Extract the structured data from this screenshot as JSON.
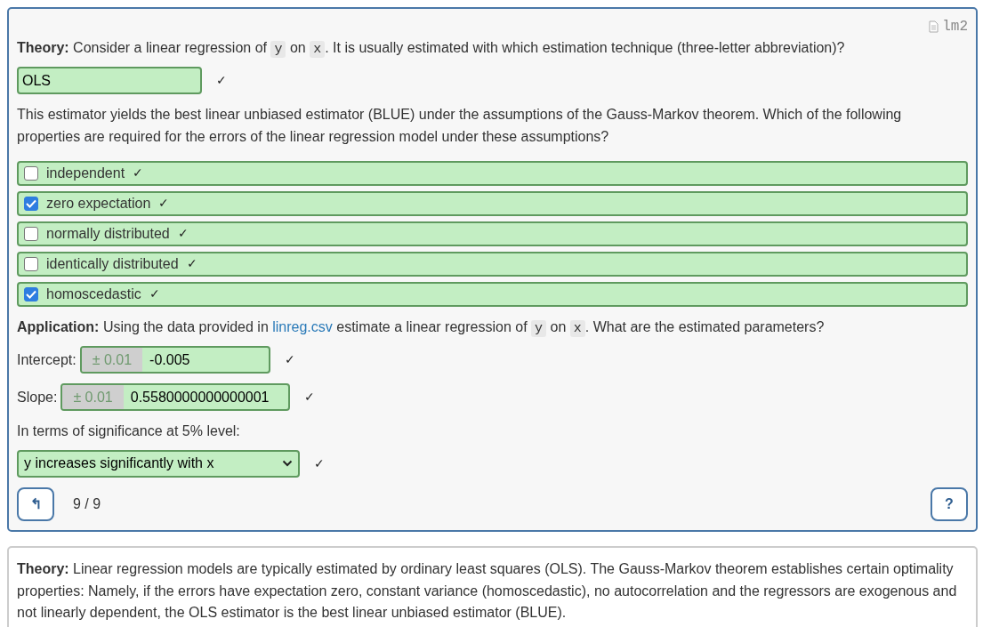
{
  "exercise": {
    "file_label": "lm2",
    "blocks": [
      {
        "kind": "prompt",
        "segments": [
          {
            "kind": "bold",
            "text": "Theory:"
          },
          {
            "kind": "text",
            "text": " Consider a linear regression of "
          },
          {
            "kind": "code",
            "text": "y"
          },
          {
            "kind": "text",
            "text": " on "
          },
          {
            "kind": "code",
            "text": "x"
          },
          {
            "kind": "text",
            "text": ". It is usually estimated with which estimation technique (three-letter abbreviation)?"
          }
        ]
      },
      {
        "kind": "text_answer",
        "value": "OLS",
        "correct": true,
        "mark": "✓"
      },
      {
        "kind": "prompt",
        "segments": [
          {
            "kind": "text",
            "text": "This estimator yields the best linear unbiased estimator (BLUE) under the assumptions of the Gauss-Markov theorem. Which of the following properties are required for the errors of the linear regression model under these assumptions?"
          }
        ]
      },
      {
        "kind": "checklist",
        "options": [
          {
            "label": "independent",
            "checked": false,
            "correct": true,
            "mark": "✓"
          },
          {
            "label": "zero expectation",
            "checked": true,
            "correct": true,
            "mark": "✓"
          },
          {
            "label": "normally distributed",
            "checked": false,
            "correct": true,
            "mark": "✓"
          },
          {
            "label": "identically distributed",
            "checked": false,
            "correct": true,
            "mark": "✓"
          },
          {
            "label": "homoscedastic",
            "checked": true,
            "correct": true,
            "mark": "✓"
          }
        ]
      },
      {
        "kind": "prompt",
        "segments": [
          {
            "kind": "bold",
            "text": "Application:"
          },
          {
            "kind": "text",
            "text": " Using the data provided in "
          },
          {
            "kind": "link",
            "text": "linreg.csv"
          },
          {
            "kind": "text",
            "text": " estimate a linear regression of "
          },
          {
            "kind": "code",
            "text": "y"
          },
          {
            "kind": "text",
            "text": " on "
          },
          {
            "kind": "code",
            "text": "x"
          },
          {
            "kind": "text",
            "text": ". What are the estimated parameters?"
          }
        ]
      },
      {
        "kind": "numeric",
        "label": "Intercept:",
        "tolerance": "± 0.01",
        "value": "-0.005",
        "correct": true,
        "mark": "✓"
      },
      {
        "kind": "numeric",
        "label": "Slope:",
        "tolerance": "± 0.01",
        "value": "0.5580000000000001",
        "correct": true,
        "mark": "✓"
      },
      {
        "kind": "prompt",
        "segments": [
          {
            "kind": "text",
            "text": "In terms of significance at 5% level:"
          }
        ]
      },
      {
        "kind": "select",
        "value": "y increases significantly with x",
        "correct": true,
        "mark": "✓"
      }
    ],
    "footer": {
      "back_button": "↰",
      "progress": "9 / 9",
      "help_button": "?"
    }
  },
  "solution": {
    "segments": [
      {
        "kind": "bold",
        "text": "Theory:"
      },
      {
        "kind": "text",
        "text": " Linear regression models are typically estimated by ordinary least squares (OLS). The Gauss-Markov theorem establishes certain optimality properties: Namely, if the errors have expectation zero, constant variance (homoscedastic), no autocorrelation and the regressors are exogenous and not linearly dependent, the OLS estimator is the best linear unbiased estimator (BLUE)."
      }
    ]
  }
}
